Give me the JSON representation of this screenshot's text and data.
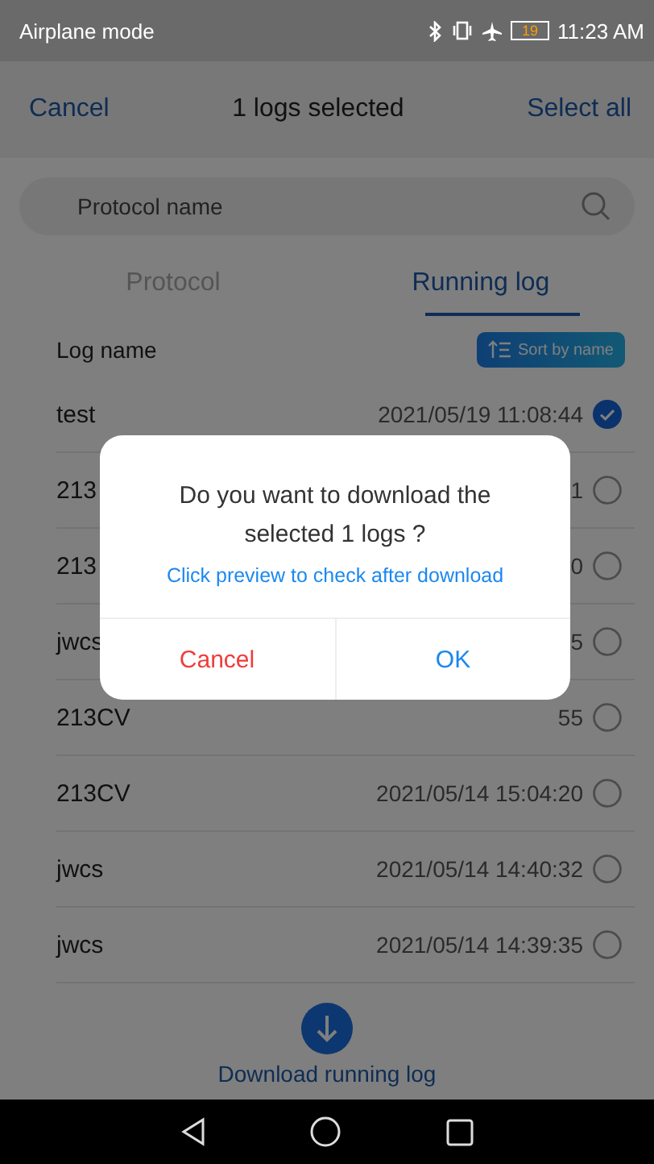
{
  "status_bar": {
    "carrier": "Airplane mode",
    "battery": "19",
    "time": "11:23 AM"
  },
  "header": {
    "cancel": "Cancel",
    "title": "1 logs selected",
    "select_all": "Select all"
  },
  "search": {
    "placeholder": "Protocol name"
  },
  "tabs": [
    {
      "label": "Protocol",
      "selected": false
    },
    {
      "label": "Running log",
      "selected": true
    }
  ],
  "list_header": {
    "label": "Log name",
    "sort_button": "Sort by name"
  },
  "rows": [
    {
      "name": "test",
      "time": "2021/05/19 11:08:44",
      "selected": true
    },
    {
      "name": "213",
      "time": "1",
      "selected": false
    },
    {
      "name": "213",
      "time": "0",
      "selected": false
    },
    {
      "name": "jwcs",
      "time": "5",
      "selected": false
    },
    {
      "name": "213CV",
      "time": "55",
      "selected": false
    },
    {
      "name": "213CV",
      "time": "2021/05/14 15:04:20",
      "selected": false
    },
    {
      "name": "jwcs",
      "time": "2021/05/14 14:40:32",
      "selected": false
    },
    {
      "name": "jwcs",
      "time": "2021/05/14 14:39:35",
      "selected": false
    }
  ],
  "download": {
    "label": "Download running log"
  },
  "dialog": {
    "message": "Do you want to download the selected 1 logs ?",
    "hint": "Click preview to check after download",
    "cancel": "Cancel",
    "ok": "OK"
  }
}
